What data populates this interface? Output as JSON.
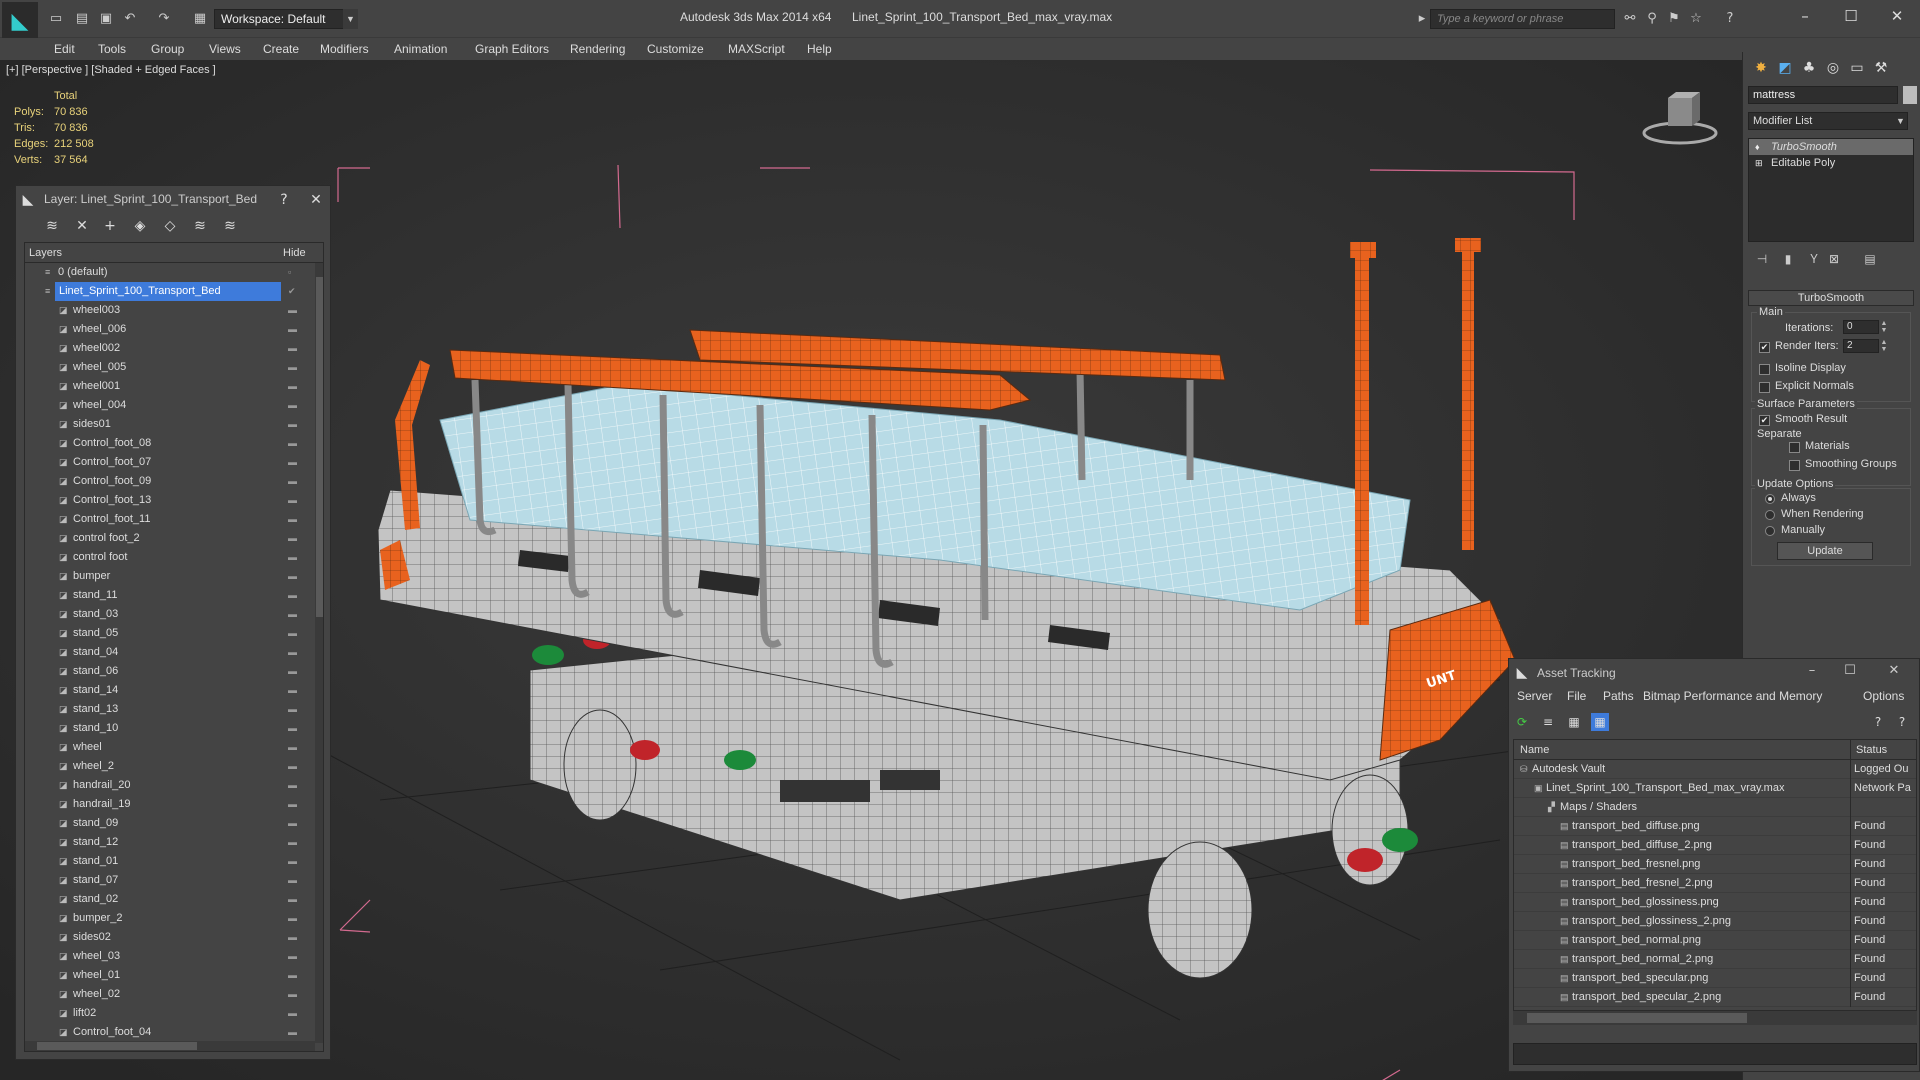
{
  "titlebar": {
    "app_title": "Autodesk 3ds Max  2014 x64",
    "file_title": "Linet_Sprint_100_Transport_Bed_max_vray.max",
    "workspace": "Workspace: Default",
    "search_placeholder": "Type a keyword or phrase"
  },
  "menu": [
    "Edit",
    "Tools",
    "Group",
    "Views",
    "Create",
    "Modifiers",
    "Animation",
    "Graph Editors",
    "Rendering",
    "Customize",
    "MAXScript",
    "Help"
  ],
  "viewport": {
    "label": "[+] [Perspective ] [Shaded + Edged Faces ]",
    "stats": {
      "header": "Total",
      "rows": [
        {
          "k": "Polys:",
          "v": "70 836"
        },
        {
          "k": "Tris:",
          "v": "70 836"
        },
        {
          "k": "Edges:",
          "v": "212 508"
        },
        {
          "k": "Verts:",
          "v": "37 564"
        }
      ]
    }
  },
  "layer_dialog": {
    "title": "Layer: Linet_Sprint_100_Transport_Bed",
    "help": "?",
    "close": "✕",
    "col_layers": "Layers",
    "col_hide": "Hide",
    "top_layers": [
      "0 (default)",
      "Linet_Sprint_100_Transport_Bed"
    ],
    "children": [
      "wheel003",
      "wheel_006",
      "wheel002",
      "wheel_005",
      "wheel001",
      "wheel_004",
      "sides01",
      "Control_foot_08",
      "Control_foot_07",
      "Control_foot_09",
      "Control_foot_13",
      "Control_foot_11",
      "control foot_2",
      "control foot",
      "bumper",
      "stand_11",
      "stand_03",
      "stand_05",
      "stand_04",
      "stand_06",
      "stand_14",
      "stand_13",
      "stand_10",
      "wheel",
      "wheel_2",
      "handrail_20",
      "handrail_19",
      "stand_09",
      "stand_12",
      "stand_01",
      "stand_07",
      "stand_02",
      "bumper_2",
      "sides02",
      "wheel_03",
      "wheel_01",
      "wheel_02",
      "lift02",
      "Control_foot_04"
    ]
  },
  "command_panel": {
    "object_name": "mattress",
    "modifier_list": "Modifier List",
    "stack": [
      "TurboSmooth",
      "Editable Poly"
    ],
    "turbosmooth": {
      "header": "TurboSmooth",
      "main": "Main",
      "iterations_label": "Iterations:",
      "iterations": "0",
      "render_iters_label": "Render Iters:",
      "render_iters": "2",
      "isoline": "Isoline Display",
      "explicit": "Explicit Normals",
      "surface_params": "Surface Parameters",
      "smooth_result": "Smooth Result",
      "separate": "Separate",
      "materials": "Materials",
      "smoothing_groups": "Smoothing Groups",
      "update_options": "Update Options",
      "always": "Always",
      "when_rendering": "When Rendering",
      "manually": "Manually",
      "update": "Update"
    }
  },
  "asset_tracking": {
    "title": "Asset Tracking",
    "menu": [
      "Server",
      "File",
      "Paths",
      "Bitmap Performance and Memory",
      "Options"
    ],
    "col_name": "Name",
    "col_status": "Status",
    "rows": [
      {
        "name": "Autodesk Vault",
        "status": "Logged Ou",
        "level": 0
      },
      {
        "name": "Linet_Sprint_100_Transport_Bed_max_vray.max",
        "status": "Network Pa",
        "level": 1
      },
      {
        "name": "Maps / Shaders",
        "status": "",
        "level": 2
      },
      {
        "name": "transport_bed_diffuse.png",
        "status": "Found",
        "level": 3
      },
      {
        "name": "transport_bed_diffuse_2.png",
        "status": "Found",
        "level": 3
      },
      {
        "name": "transport_bed_fresnel.png",
        "status": "Found",
        "level": 3
      },
      {
        "name": "transport_bed_fresnel_2.png",
        "status": "Found",
        "level": 3
      },
      {
        "name": "transport_bed_glossiness.png",
        "status": "Found",
        "level": 3
      },
      {
        "name": "transport_bed_glossiness_2.png",
        "status": "Found",
        "level": 3
      },
      {
        "name": "transport_bed_normal.png",
        "status": "Found",
        "level": 3
      },
      {
        "name": "transport_bed_normal_2.png",
        "status": "Found",
        "level": 3
      },
      {
        "name": "transport_bed_specular.png",
        "status": "Found",
        "level": 3
      },
      {
        "name": "transport_bed_specular_2.png",
        "status": "Found",
        "level": 3
      }
    ]
  },
  "colors": {
    "accent_orange": "#e8621e",
    "mattress": "#b8dbe6",
    "frame_gray": "#bdbdbd",
    "selection_blue": "#3e7bdb",
    "stats_yellow": "#e8d27a"
  }
}
